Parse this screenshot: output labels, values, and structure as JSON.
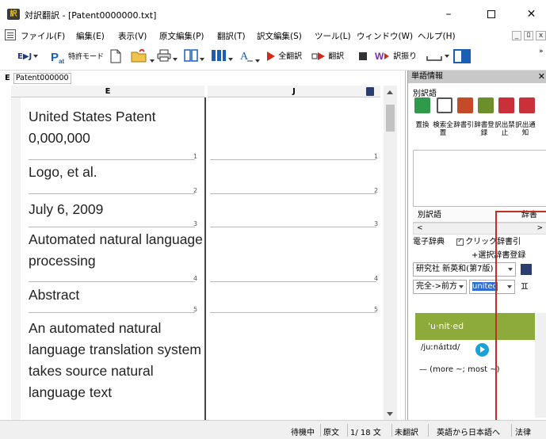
{
  "window": {
    "app_icon": "訳",
    "title": "対訳翻訳 - [Patent0000000.txt]",
    "minimize": "–",
    "close": "✕"
  },
  "menubar": {
    "items": [
      "ファイル(F)",
      "編集(E)",
      "表示(V)",
      "原文編集(P)",
      "翻訳(T)",
      "訳文編集(S)",
      "ツール(L)",
      "ウィンドウ(W)",
      "ヘルプ(H)"
    ],
    "mdi_min": "_",
    "mdi_restore": "ﾛ",
    "mdi_close": "x"
  },
  "toolbar": {
    "direction": "E▶J",
    "patent_mode": "特許モード",
    "translate_all": "全翻訳",
    "translate": "翻訳",
    "assign_translation": "訳振り",
    "overflow": "»"
  },
  "document": {
    "tab_label": "E",
    "tab_field": "Patent000000",
    "col_e": "E",
    "col_j": "J",
    "segments": [
      {
        "text": "United States Patent 0,000,000",
        "num": "1"
      },
      {
        "text": "Logo, et al.",
        "num": "2"
      },
      {
        "text": "July 6, 2009",
        "num": "3"
      },
      {
        "text": "Automated natural language processing",
        "num": "4"
      },
      {
        "text": "Abstract",
        "num": "5"
      },
      {
        "text": "An automated natural language translation system takes source natural language text",
        "num": ""
      }
    ]
  },
  "word_info": {
    "header": "単語情報",
    "close": "✕",
    "alt_translation": "別訳語",
    "icon_labels": [
      "置換",
      "検索全置",
      "辞書引",
      "辞書登録",
      "訳出禁止",
      "訳出通知"
    ],
    "grid_col1": "別訳語",
    "grid_col2": "辞書",
    "edict_title": "電子辞典",
    "click_lookup": "クリック辞書引",
    "select_dict": "+選択辞書登録",
    "dictionary": "研究社 新英和(第7版)",
    "match_mode": "完全->前方",
    "search_word": "united",
    "entry_head": "ˈu·nit·ed",
    "pronunciation": "/juːnáɪtɪd/",
    "definition": "— (more ~; most ~)"
  },
  "statusbar": {
    "state": "待機中",
    "view": "原文",
    "position": "1/ 18 文",
    "untranslated": "未翻訳",
    "direction": "英語から日本語へ",
    "field": "法律"
  }
}
